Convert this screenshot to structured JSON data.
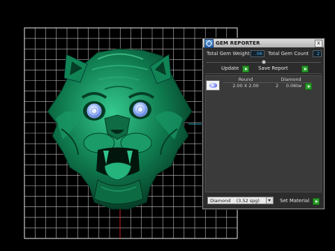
{
  "colors": {
    "grid": "#e6e6e6",
    "axis_x": "#1ca7b5",
    "axis_y": "#c21a1a",
    "model": "#0f7a4e",
    "gem": "#8fb6ff",
    "accent_button": "#2f9a2f"
  },
  "panel": {
    "title": "GEM REPORTER",
    "close_label": "x",
    "total_weight_label": "Total Gem Weight",
    "total_weight_value": ".06",
    "total_count_label": "Total Gem Count",
    "total_count_value": "2",
    "update_label": "Update",
    "save_report_label": "Save Report",
    "columns": [
      "Round",
      "Diamond"
    ],
    "gem_row": {
      "shape": "Round",
      "size": "2.00 X 2.00",
      "count": "2",
      "weight": "0.06tw",
      "icon": "round-diamond-icon"
    },
    "material_select_value": "Diamond    (3.52 spg)",
    "set_material_label": "Set Material"
  },
  "viewport": {
    "model_icon": "tiger-head-model"
  }
}
